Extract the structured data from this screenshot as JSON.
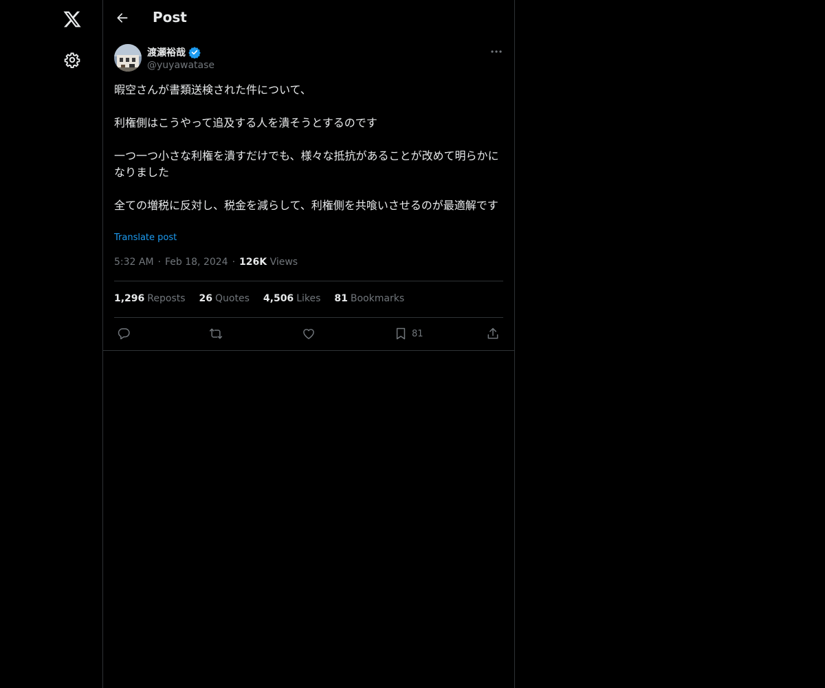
{
  "nav": {
    "logo_icon": "x-logo-icon",
    "settings_icon": "gear-icon"
  },
  "header": {
    "title": "Post"
  },
  "post": {
    "author_name": "渡瀬裕哉",
    "author_handle": "@yuyawatase",
    "verified": true,
    "text": "暇空さんが書類送検された件について、\n\n利権側はこうやって追及する人を潰そうとするのです\n\n一つ一つ小さな利権を潰すだけでも、様々な抵抗があることが改めて明らかになりました\n\n全ての増税に反対し、税金を減らして、利権側を共喰いさせるのが最適解です",
    "translate_label": "Translate post",
    "time": "5:32 AM",
    "date": "Feb 18, 2024",
    "views_count": "126K",
    "views_label": "Views"
  },
  "stats": {
    "reposts_count": "1,296",
    "reposts_label": "Reposts",
    "quotes_count": "26",
    "quotes_label": "Quotes",
    "likes_count": "4,506",
    "likes_label": "Likes",
    "bookmarks_count": "81",
    "bookmarks_label": "Bookmarks"
  },
  "actions": {
    "bookmark_count": "81"
  },
  "colors": {
    "background": "#000000",
    "text_primary": "#e7e9ea",
    "text_secondary": "#71767b",
    "accent": "#1d9bf0",
    "border": "#2f3336"
  }
}
